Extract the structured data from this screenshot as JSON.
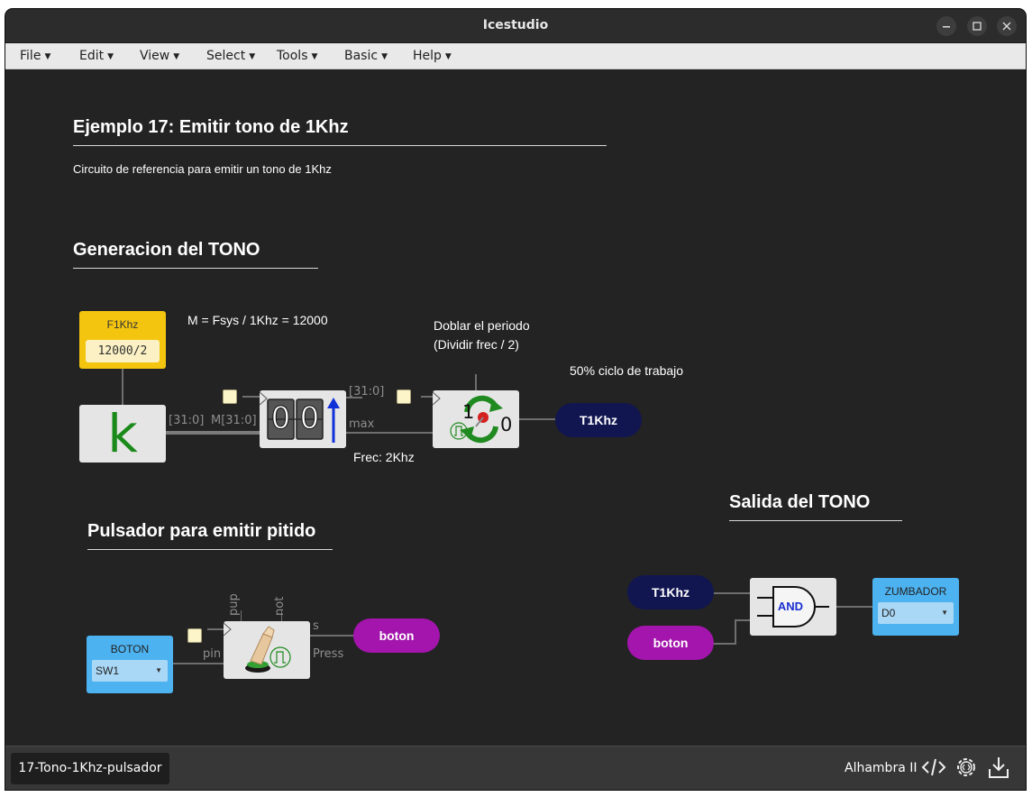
{
  "window": {
    "title": "Icestudio"
  },
  "menu": [
    {
      "label": "File"
    },
    {
      "label": "Edit"
    },
    {
      "label": "View"
    },
    {
      "label": "Select"
    },
    {
      "label": "Tools"
    },
    {
      "label": "Basic"
    },
    {
      "label": "Help"
    }
  ],
  "headings": {
    "main": "Ejemplo 17: Emitir tono de 1Khz",
    "generation": "Generacion del TONO",
    "button": "Pulsador para emitir pitido",
    "output": "Salida del TONO"
  },
  "notes": {
    "description": "Circuito de referencia para emitir un tono de 1Khz",
    "formula": "M = Fsys / 1Khz = 12000",
    "double_line1": "Doblar el periodo",
    "double_line2": "(Dividir frec / 2)",
    "duty": "50% ciclo de trabajo",
    "freq": "Frec: 2Khz"
  },
  "constant": {
    "label": "F1Khz",
    "value": "12000/2",
    "symbol": "k"
  },
  "ports": {
    "bus1": "[31:0]",
    "m": "M[31:0]",
    "bus2": "[31:0]",
    "max": "max",
    "pup": "pup",
    "not": "not",
    "pin": "pin",
    "s": "s",
    "press": "Press"
  },
  "counter": {
    "digit1": "0",
    "digit2": "0"
  },
  "toggle": {
    "one": "1",
    "zero": "0"
  },
  "labels": {
    "t1khz_out": "T1Khz",
    "boton_out": "boton",
    "t1khz_in": "T1Khz",
    "boton_in": "boton",
    "and": "AND"
  },
  "inputs": {
    "boton": {
      "label": "BOTON",
      "value": "SW1"
    },
    "zumbador": {
      "label": "ZUMBADOR",
      "value": "D0"
    }
  },
  "status": {
    "tab": "17-Tono-1Khz-pulsador",
    "board": "Alhambra II"
  },
  "colors": {
    "canvas": "#232323",
    "constant": "#f4c50f",
    "io": "#4db2f0",
    "label_navy": "#111650",
    "label_magenta": "#a315ac"
  }
}
